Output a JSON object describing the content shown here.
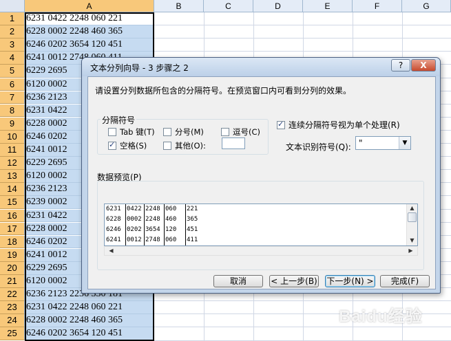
{
  "spreadsheet": {
    "columns": [
      "A",
      "B",
      "C",
      "D",
      "E",
      "F",
      "G"
    ],
    "selected_column": "A",
    "rows": [
      {
        "num": "1",
        "a": "6231 0422 2248 060 221"
      },
      {
        "num": "2",
        "a": "6228 0002 2248 460 365"
      },
      {
        "num": "3",
        "a": "6246 0202 3654 120 451"
      },
      {
        "num": "4",
        "a": "6241 0012 2748 060 411"
      },
      {
        "num": "5",
        "a": "6229 2695"
      },
      {
        "num": "6",
        "a": "6120 0002"
      },
      {
        "num": "7",
        "a": "6236 2123"
      },
      {
        "num": "8",
        "a": "6231 0422"
      },
      {
        "num": "9",
        "a": "6228 0002"
      },
      {
        "num": "10",
        "a": "6246 0202"
      },
      {
        "num": "11",
        "a": "6241 0012"
      },
      {
        "num": "12",
        "a": "6229 2695"
      },
      {
        "num": "13",
        "a": "6120 0002"
      },
      {
        "num": "14",
        "a": "6236 2123"
      },
      {
        "num": "15",
        "a": "6239 0002"
      },
      {
        "num": "16",
        "a": "6231 0422"
      },
      {
        "num": "17",
        "a": "6228 0002"
      },
      {
        "num": "18",
        "a": "6246 0202"
      },
      {
        "num": "19",
        "a": "6241 0012"
      },
      {
        "num": "20",
        "a": "6229 2695"
      },
      {
        "num": "21",
        "a": "6120 0002"
      },
      {
        "num": "22",
        "a": "6236 2123 2236 330 181"
      },
      {
        "num": "23",
        "a": "6231 0422 2248 060 221"
      },
      {
        "num": "24",
        "a": "6228 0002 2248 460 365"
      },
      {
        "num": "25",
        "a": "6246 0202 3654 120 451"
      }
    ]
  },
  "dialog": {
    "title": "文本分列向导 - 3 步骤之 2",
    "help_label": "?",
    "close_label": "X",
    "intro": "请设置分列数据所包含的分隔符号。在预览窗口内可看到分列的效果。",
    "delimiters": {
      "title": "分隔符号",
      "tab": {
        "label": "Tab 键(T)",
        "checked": false
      },
      "semicolon": {
        "label": "分号(M)",
        "checked": false
      },
      "comma": {
        "label": "逗号(C)",
        "checked": false
      },
      "space": {
        "label": "空格(S)",
        "checked": true
      },
      "other": {
        "label": "其他(O):",
        "checked": false,
        "value": ""
      }
    },
    "consecutive": {
      "label": "连续分隔符号视为单个处理(R)",
      "checked": true
    },
    "qualifier": {
      "label": "文本识别符号(Q):",
      "value": "\""
    },
    "preview": {
      "title": "数据预览(P)",
      "rows": [
        [
          "6231",
          "0422",
          "2248",
          "060",
          "221"
        ],
        [
          "6228",
          "0002",
          "2248",
          "460",
          "365"
        ],
        [
          "6246",
          "0202",
          "3654",
          "120",
          "451"
        ],
        [
          "6241",
          "0012",
          "2748",
          "060",
          "411"
        ]
      ]
    },
    "buttons": {
      "cancel": "取消",
      "back": "< 上一步(B)",
      "next": "下一步(N) >",
      "finish": "完成(F)"
    }
  },
  "watermark": "Baidu经验"
}
